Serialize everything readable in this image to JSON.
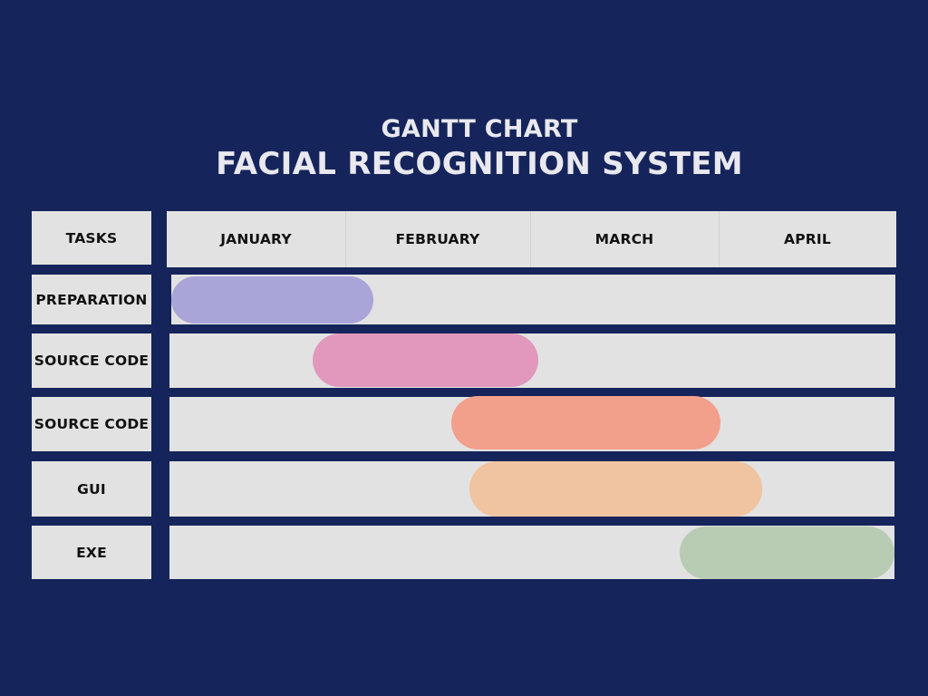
{
  "subtitle": "GANTT CHART",
  "title": "FACIAL RECOGNITION SYSTEM",
  "tasks_header": "TASKS",
  "chart_data": {
    "type": "gantt",
    "title": "FACIAL RECOGNITION SYSTEM",
    "subtitle": "GANTT CHART",
    "months": [
      "JANUARY",
      "FEBRUARY",
      "MARCH",
      "APRIL"
    ],
    "tasks": [
      {
        "name": "PREPARATION",
        "start": 0.0,
        "end": 1.12,
        "color": "#aaa5d8"
      },
      {
        "name": "SOURCE CODE",
        "start": 0.78,
        "end": 2.03,
        "color": "#e298bc"
      },
      {
        "name": "SOURCE CODE",
        "start": 1.55,
        "end": 3.04,
        "color": "#f29f8c"
      },
      {
        "name": "GUI",
        "start": 1.65,
        "end": 3.27,
        "color": "#f1c4a1"
      },
      {
        "name": "EXE",
        "start": 2.81,
        "end": 4.0,
        "color": "#b8cbb3"
      }
    ]
  }
}
